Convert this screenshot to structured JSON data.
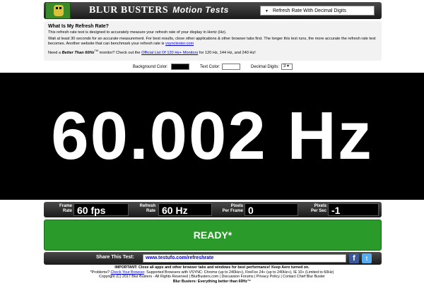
{
  "header": {
    "brand": "BLUR BUSTERS",
    "brand_sub": "Motion Tests",
    "test_select": "Refresh Rate With Decimal Digits"
  },
  "intro": {
    "title": "What Is My Refresh Rate?",
    "p1": "This refresh rate test is designed to accurately measure your refresh rate of your display in Hertz (Hz).",
    "p2": "Wait at least 30 seconds for an accurate measurement. For best results, close other applications & other browser tabs first. The longer this test runs, the more accurate the refresh rate test becomes. Another website that can benchmark your refresh rate is",
    "p2_link": "vsynctester.com",
    "p3_a": "Need a",
    "p3_b": "Better Than 60Hz",
    "p3_tm": "TM",
    "p3_c": "monitor? Check out the",
    "p3_link": "Official List Of 120 Hz+ Monitors",
    "p3_d": "for 120 Hz, 144 Hz, and 240 Hz!"
  },
  "controls": {
    "bg_label": "Background Color:",
    "text_label": "Text Color:",
    "digits_label": "Decimal Digits:",
    "digits_value": "3 ▾",
    "bg_color": "#000000",
    "text_color": "#ffffff"
  },
  "display": {
    "rate": "60.002 Hz"
  },
  "stats": {
    "frame_rate_label_1": "Frame",
    "frame_rate_label_2": "Rate",
    "frame_rate_value": "60 fps",
    "refresh_rate_label_1": "Refresh",
    "refresh_rate_label_2": "Rate",
    "refresh_rate_value": "60 Hz",
    "pixels_frame_label_1": "Pixels",
    "pixels_frame_label_2": "Per Frame",
    "pixels_frame_value": "0",
    "pixels_sec_label_1": "Pixels",
    "pixels_sec_label_2": "Per Sec",
    "pixels_sec_value": "-1"
  },
  "status": {
    "ready_label": "READY*"
  },
  "share": {
    "label": "Share This Test:",
    "url": "www.testufo.com/refreshrate",
    "fb": "f",
    "tw": "t"
  },
  "footer": {
    "line1": "IMPORTANT: Close all apps and other browser tabs and windows for best performance! Keep Aero turned on.",
    "line2_a": "*Problems?",
    "line2_link": "Check Your Browser",
    "line2_b": ". Supported Browsers with VSYNC: Chrome (up to 240Hz+), FireFox 24+ (up to 240Hz+), IE 10+ (Limited to 60Hz)",
    "line3": "Copyright (C) 2017 Blur Busters - All Rights Reserved | BlurBusters.com | Discussion Forums | Privacy Policy | Contact Chief Blur Buster",
    "line4": "Blur Busters: Everything better than 60Hz™"
  }
}
